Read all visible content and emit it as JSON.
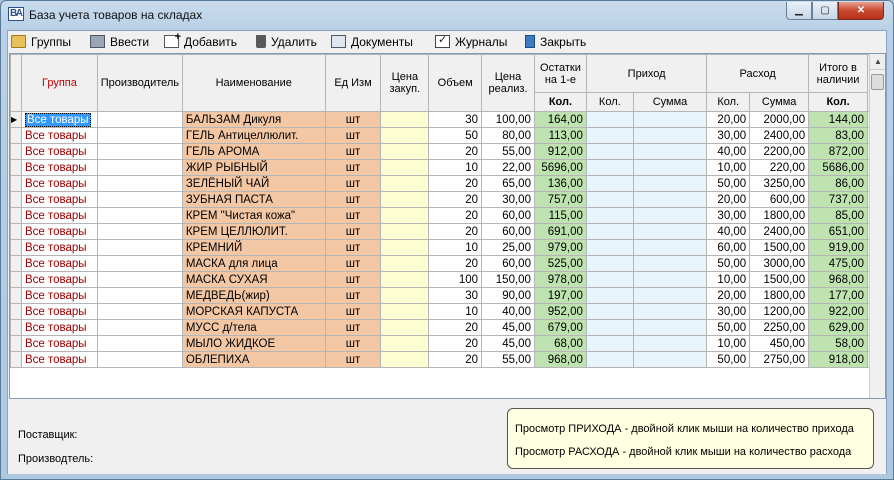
{
  "window": {
    "title": "База учета товаров на складах",
    "app_icon_text": "ВА"
  },
  "toolbar": {
    "items": [
      {
        "label": "Группы",
        "icon": "folder-icon"
      },
      {
        "label": "Ввести",
        "icon": "keyboard-icon"
      },
      {
        "label": "Добавить",
        "icon": "add-document-icon"
      },
      {
        "label": "Удалить",
        "icon": "trash-icon"
      },
      {
        "label": "Документы",
        "icon": "documents-icon"
      },
      {
        "label": "Журналы",
        "icon": "journal-icon"
      },
      {
        "label": "Закрыть",
        "icon": "exit-door-icon"
      }
    ]
  },
  "grid": {
    "headers": {
      "group": "Группа",
      "manufacturer": "Производитель",
      "name": "Наименование",
      "unit": "Ед Изм",
      "price_buy": [
        "Цена",
        "закуп."
      ],
      "volume": "Объем",
      "price_sell": [
        "Цена",
        "реализ."
      ],
      "opening": [
        "Остатки",
        "на 1-е"
      ],
      "income": "Приход",
      "outcome": "Расход",
      "total": [
        "Итого в",
        "наличии"
      ],
      "qty_bold": "Кол.",
      "qty": "Кол.",
      "sum": "Сумма"
    },
    "rows": [
      {
        "group": "Все товары",
        "name": "БАЛЬЗАМ Дикуля",
        "unit": "шт",
        "volume": "30",
        "price_sell": "100,00",
        "opening": "164,00",
        "out_qty": "20,00",
        "out_sum": "2000,00",
        "total": "144,00"
      },
      {
        "group": "Все товары",
        "name": "ГЕЛЬ Антицеллюлит.",
        "unit": "шт",
        "volume": "50",
        "price_sell": "80,00",
        "opening": "113,00",
        "out_qty": "30,00",
        "out_sum": "2400,00",
        "total": "83,00"
      },
      {
        "group": "Все товары",
        "name": "ГЕЛЬ АРОМА",
        "unit": "шт",
        "volume": "20",
        "price_sell": "55,00",
        "opening": "912,00",
        "out_qty": "40,00",
        "out_sum": "2200,00",
        "total": "872,00"
      },
      {
        "group": "Все товары",
        "name": "ЖИР РЫБНЫЙ",
        "unit": "шт",
        "volume": "10",
        "price_sell": "22,00",
        "opening": "5696,00",
        "out_qty": "10,00",
        "out_sum": "220,00",
        "total": "5686,00"
      },
      {
        "group": "Все товары",
        "name": "ЗЕЛЁНЫЙ ЧАЙ",
        "unit": "шт",
        "volume": "20",
        "price_sell": "65,00",
        "opening": "136,00",
        "out_qty": "50,00",
        "out_sum": "3250,00",
        "total": "86,00"
      },
      {
        "group": "Все товары",
        "name": "ЗУБНАЯ ПАСТА",
        "unit": "шт",
        "volume": "20",
        "price_sell": "30,00",
        "opening": "757,00",
        "out_qty": "20,00",
        "out_sum": "600,00",
        "total": "737,00"
      },
      {
        "group": "Все товары",
        "name": "КРЕМ \"Чистая кожа\"",
        "unit": "шт",
        "volume": "20",
        "price_sell": "60,00",
        "opening": "115,00",
        "out_qty": "30,00",
        "out_sum": "1800,00",
        "total": "85,00"
      },
      {
        "group": "Все товары",
        "name": "КРЕМ ЦЕЛЛЮЛИТ.",
        "unit": "шт",
        "volume": "20",
        "price_sell": "60,00",
        "opening": "691,00",
        "out_qty": "40,00",
        "out_sum": "2400,00",
        "total": "651,00"
      },
      {
        "group": "Все товары",
        "name": "КРЕМНИЙ",
        "unit": "шт",
        "volume": "10",
        "price_sell": "25,00",
        "opening": "979,00",
        "out_qty": "60,00",
        "out_sum": "1500,00",
        "total": "919,00"
      },
      {
        "group": "Все товары",
        "name": "МАСКА  для лица",
        "unit": "шт",
        "volume": "20",
        "price_sell": "60,00",
        "opening": "525,00",
        "out_qty": "50,00",
        "out_sum": "3000,00",
        "total": "475,00"
      },
      {
        "group": "Все товары",
        "name": "МАСКА СУХАЯ",
        "unit": "шт",
        "volume": "100",
        "price_sell": "150,00",
        "opening": "978,00",
        "out_qty": "10,00",
        "out_sum": "1500,00",
        "total": "968,00"
      },
      {
        "group": "Все товары",
        "name": "МЕДВЕДЬ(жир)",
        "unit": "шт",
        "volume": "30",
        "price_sell": "90,00",
        "opening": "197,00",
        "out_qty": "20,00",
        "out_sum": "1800,00",
        "total": "177,00"
      },
      {
        "group": "Все товары",
        "name": "МОРСКАЯ КАПУСТА",
        "unit": "шт",
        "volume": "10",
        "price_sell": "40,00",
        "opening": "952,00",
        "out_qty": "30,00",
        "out_sum": "1200,00",
        "total": "922,00"
      },
      {
        "group": "Все товары",
        "name": "МУСС д/тела",
        "unit": "шт",
        "volume": "20",
        "price_sell": "45,00",
        "opening": "679,00",
        "out_qty": "50,00",
        "out_sum": "2250,00",
        "total": "629,00"
      },
      {
        "group": "Все товары",
        "name": "МЫЛО ЖИДКОЕ",
        "unit": "шт",
        "volume": "20",
        "price_sell": "45,00",
        "opening": "68,00",
        "out_qty": "10,00",
        "out_sum": "450,00",
        "total": "58,00"
      },
      {
        "group": "Все товары",
        "name": "ОБЛЕПИХА",
        "unit": "шт",
        "volume": "20",
        "price_sell": "55,00",
        "opening": "968,00",
        "out_qty": "50,00",
        "out_sum": "2750,00",
        "total": "918,00"
      }
    ]
  },
  "footer": {
    "supplier_label": "Поставщик:",
    "manufacturer_label": "Производтель:",
    "hint_income": "Просмотр ПРИХОДА - двойной клик мыши на количество прихода",
    "hint_outcome": "Просмотр РАСХОДА - двойной клик мыши на количество расхода"
  },
  "colors": {
    "name_cell": "#f4c7a4",
    "opening_cell": "#bfe3b0",
    "price_buy_cell": "#fdfdd2",
    "income_cell": "#e8f4fb",
    "selection": "#3399ff",
    "hint_background": "#ffffe1"
  }
}
